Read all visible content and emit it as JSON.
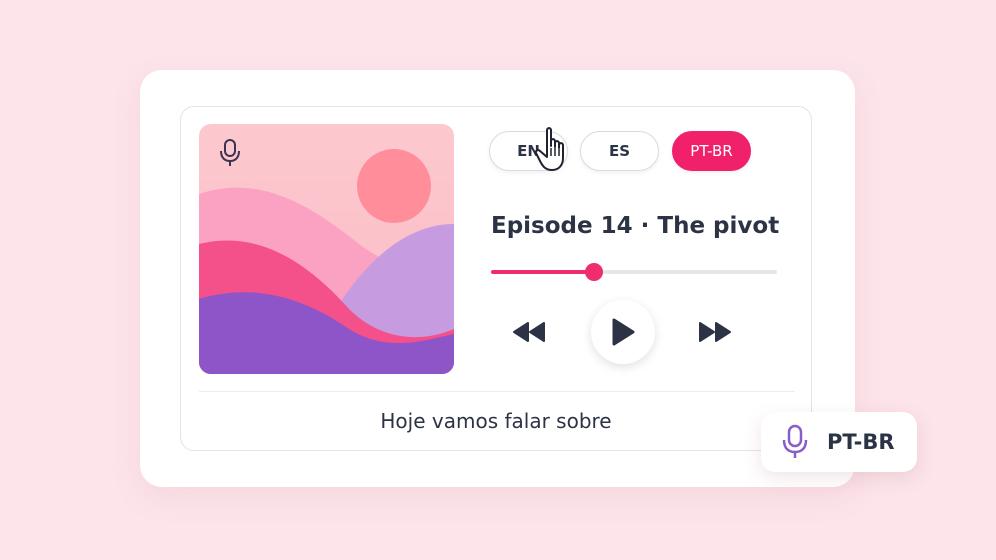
{
  "languages": [
    {
      "label": "EN",
      "selected": false
    },
    {
      "label": "ES",
      "selected": false
    },
    {
      "label": "PT-BR",
      "selected": true
    }
  ],
  "episode": {
    "title": "Episode 14 · The pivot"
  },
  "playback": {
    "progress": 0.36
  },
  "controls": {
    "rewind_icon": "rewind-icon",
    "play_icon": "play-icon",
    "forward_icon": "fast-forward-icon"
  },
  "artwork": {
    "icon": "microphone-icon"
  },
  "caption": {
    "text": "Hoje vamos falar sobre"
  },
  "language_badge": {
    "icon": "microphone-icon",
    "label": "PT-BR"
  },
  "colors": {
    "accent": "#f0216a",
    "background": "#fce4ea",
    "text": "#2b3345",
    "mic_purple": "#8a5cc8"
  }
}
